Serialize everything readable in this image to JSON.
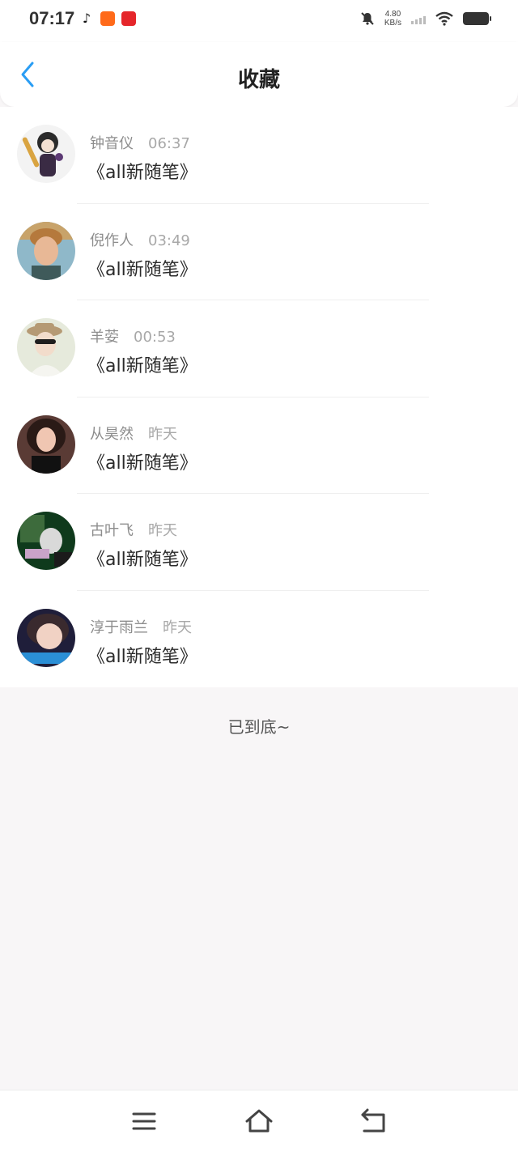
{
  "status": {
    "time": "07:17",
    "speed_value": "4.80",
    "speed_unit": "KB/s"
  },
  "header": {
    "title": "收藏"
  },
  "items": [
    {
      "name": "钟音仪",
      "time": "06:37",
      "title": "《all新随笔》"
    },
    {
      "name": "倪作人",
      "time": "03:49",
      "title": "《all新随笔》"
    },
    {
      "name": "羊荌",
      "time": "00:53",
      "title": "《all新随笔》"
    },
    {
      "name": "从昊然",
      "time": "昨天",
      "title": "《all新随笔》"
    },
    {
      "name": "古叶飞",
      "time": "昨天",
      "title": "《all新随笔》"
    },
    {
      "name": "淳于雨兰",
      "time": "昨天",
      "title": "《all新随笔》"
    }
  ],
  "footer_text": "已到底~",
  "colors": {
    "accent": "#2a9df4",
    "background": "#f8f6f7"
  },
  "icons": {
    "back": "chevron-left-icon",
    "menu": "menu-icon",
    "home": "home-icon",
    "return": "return-icon"
  }
}
